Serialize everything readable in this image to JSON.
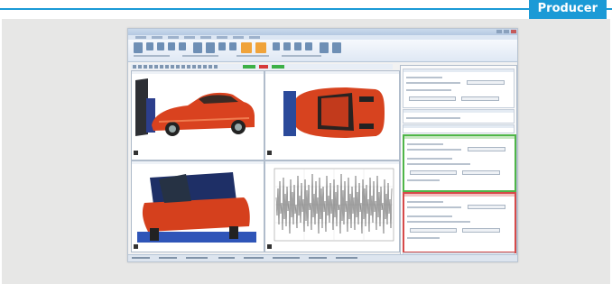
{
  "header": {
    "badge_label": "Producer",
    "accent_color": "#1b9ad6"
  },
  "app_screenshot": {
    "viewports": [
      "front-view",
      "top-view",
      "rear-view",
      "plot-view"
    ],
    "right_panel_sections": [
      "settings",
      "green-group",
      "red-group"
    ],
    "highlight_colors": {
      "green": "#4fb548",
      "red": "#d64a4a",
      "orange": "#f0a33a"
    }
  }
}
